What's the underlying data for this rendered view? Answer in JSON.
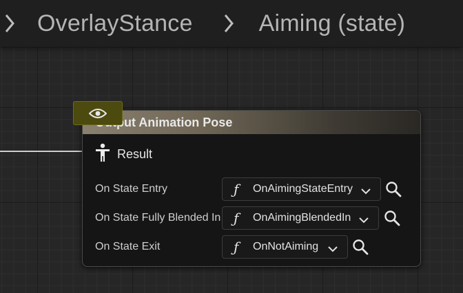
{
  "breadcrumb": {
    "items": [
      "OverlayStance",
      "Aiming (state)"
    ]
  },
  "node": {
    "title": "Output Animation Pose",
    "result_label": "Result",
    "rows": [
      {
        "label": "On State Entry",
        "value": "OnAimingStateEntry"
      },
      {
        "label": "On State Fully Blended In",
        "value": "OnAimingBlendedIn"
      },
      {
        "label": "On State Exit",
        "value": "OnNotAiming"
      }
    ]
  },
  "icons": {
    "function": "ƒ",
    "eye": "eye-icon",
    "search": "search-icon",
    "chevron": "chevron-down-icon",
    "pose": "pose-person-icon"
  },
  "colors": {
    "background": "#262626",
    "node_body": "#151515",
    "badge": "#4d4a0f"
  }
}
